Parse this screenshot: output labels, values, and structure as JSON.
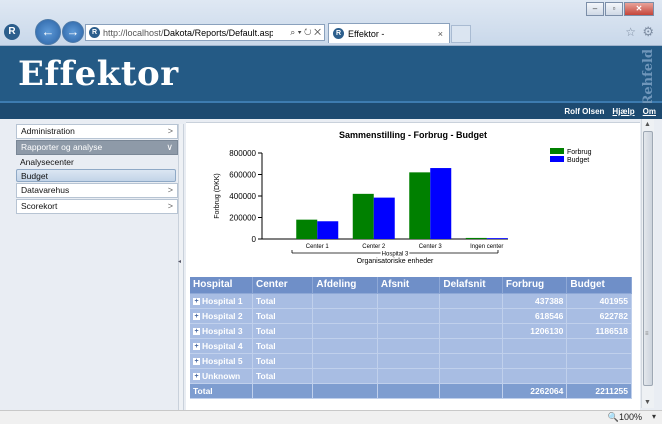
{
  "browser": {
    "url_prefix": "http://localhost/",
    "url_rest": "Dakota/Reports/Default.aspx?ReportS(",
    "url_tools": "⌕ ▾ ↻ ✕",
    "tab_title": "Effektor -",
    "tab_close": "×",
    "back_glyph": "←",
    "forward_glyph": "→",
    "favicon_glyph": "R"
  },
  "app": {
    "title": "Effektor",
    "brand": "Rehfeld"
  },
  "userbar": {
    "user": "Rolf Olsen",
    "help": "Hjælp",
    "about": "Om"
  },
  "sidebar": {
    "items": [
      {
        "label": "Administration",
        "chevron": ">"
      },
      {
        "label": "Rapporter og analyse",
        "chevron": "∨"
      },
      {
        "label": "Datavarehus",
        "chevron": ">"
      },
      {
        "label": "Scorekort",
        "chevron": ">"
      }
    ],
    "subitems": [
      "Analysecenter",
      "Budget"
    ]
  },
  "chart_data": {
    "type": "bar",
    "title": "Sammenstilling - Forbrug - Budget",
    "xlabel": "Organisatoriske enheder",
    "x_group_label": "Hospital 3",
    "ylabel": "Forbrug (DKK)",
    "categories": [
      "Center 1",
      "Center 2",
      "Center 3",
      "Ingen center"
    ],
    "series": [
      {
        "name": "Forbrug",
        "values": [
          180000,
          420000,
          620000,
          10000
        ],
        "color": "#008000"
      },
      {
        "name": "Budget",
        "values": [
          165000,
          385000,
          660000,
          8000
        ],
        "color": "#0000ff"
      }
    ],
    "ylim": [
      0,
      800000
    ],
    "yticks": [
      "800000",
      "600000",
      "400000",
      "200000",
      "0"
    ],
    "ytick_values": [
      800000,
      600000,
      400000,
      200000,
      0
    ],
    "legend": "top-right",
    "grid": false
  },
  "table": {
    "headers": [
      "Hospital",
      "Center",
      "Afdeling",
      "Afsnit",
      "Delafsnit",
      "Forbrug",
      "Budget"
    ],
    "rows": [
      {
        "hospital": "Hospital 1",
        "center": "Total",
        "forbrug": "437388",
        "budget": "401955"
      },
      {
        "hospital": "Hospital 2",
        "center": "Total",
        "forbrug": "618546",
        "budget": "622782"
      },
      {
        "hospital": "Hospital 3",
        "center": "Total",
        "forbrug": "1206130",
        "budget": "1186518"
      },
      {
        "hospital": "Hospital 4",
        "center": "Total",
        "forbrug": "",
        "budget": ""
      },
      {
        "hospital": "Hospital 5",
        "center": "Total",
        "forbrug": "",
        "budget": ""
      },
      {
        "hospital": "Unknown",
        "center": "Total",
        "forbrug": "",
        "budget": ""
      }
    ],
    "total": {
      "label": "Total",
      "forbrug": "2262064",
      "budget": "2211255"
    },
    "expand_glyph": "+"
  },
  "statusbar": {
    "zoom": "100%",
    "zoom_arrow": "▾"
  }
}
